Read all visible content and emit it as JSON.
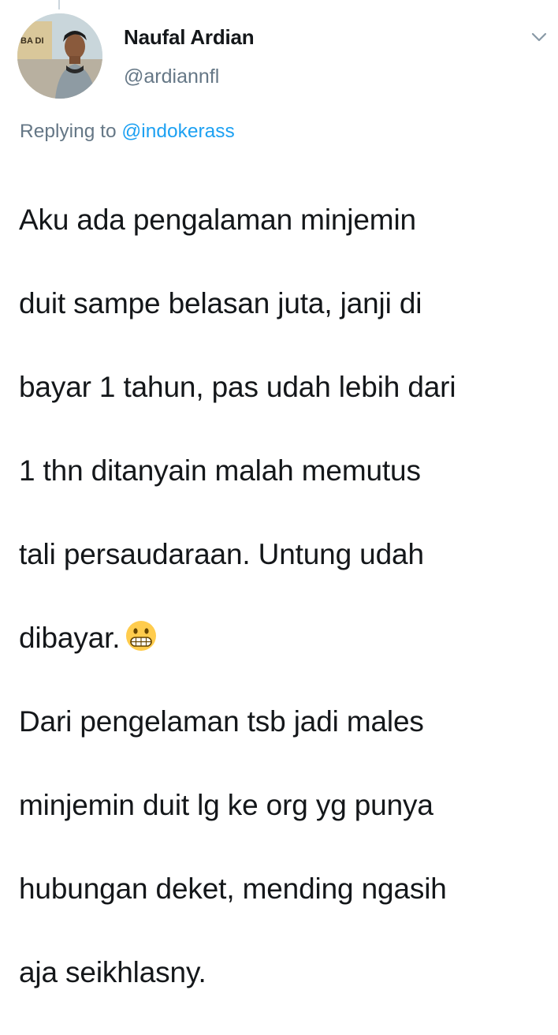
{
  "author": {
    "display_name": "Naufal Ardian",
    "handle": "@ardiannfl",
    "avatar_sign_text": "BA DI"
  },
  "reply": {
    "prefix": "Replying to ",
    "mention": "@indokerass"
  },
  "tweet": {
    "lines": [
      "Aku ada pengalaman minjemin",
      "duit sampe belasan juta, janji di",
      "bayar 1 tahun, pas udah lebih dari",
      "1 thn ditanyain malah memutus",
      "tali persaudaraan. Untung udah",
      "dibayar.",
      "Dari pengelaman tsb jadi males",
      "minjemin duit lg ke org yg punya",
      "hubungan deket, mending ngasih",
      "aja seikhlasny."
    ],
    "emoji": "grinning-face-with-teeth-emoji"
  },
  "icons": {
    "menu_caret": "chevron-down-icon"
  },
  "colors": {
    "text_primary": "#14171a",
    "text_secondary": "#657786",
    "link": "#1da1f2",
    "thread_line": "#ccd6dd"
  }
}
